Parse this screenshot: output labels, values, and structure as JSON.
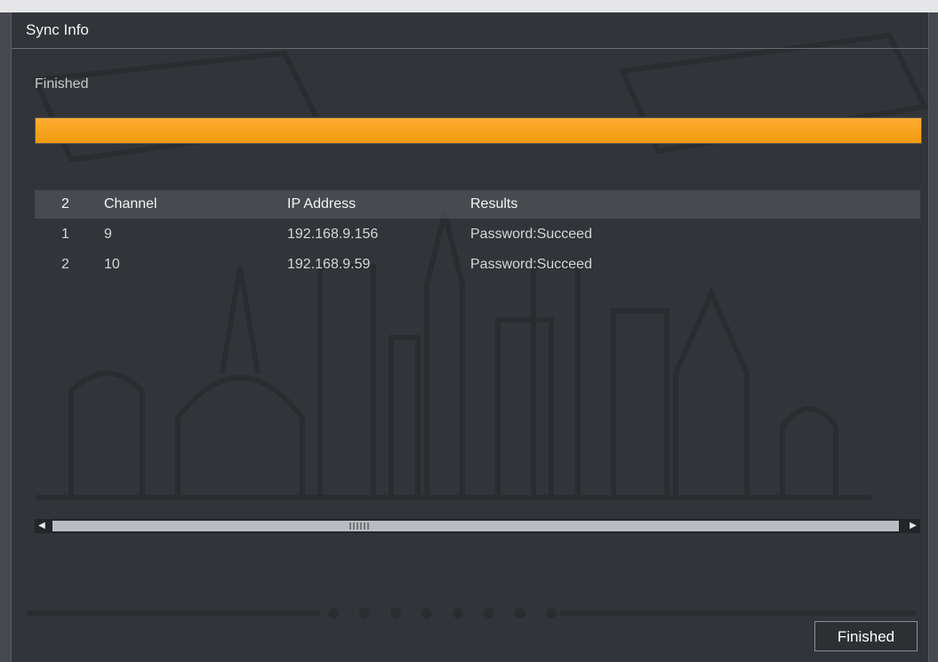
{
  "dialog": {
    "title": "Sync Info",
    "status": "Finished",
    "progress": 1.0,
    "progress_color": "#f7a21b",
    "table": {
      "count": "2",
      "headers": {
        "channel": "Channel",
        "ip": "IP Address",
        "results": "Results"
      },
      "rows": [
        {
          "index": "1",
          "channel": "9",
          "ip": "192.168.9.156",
          "result": "Password:Succeed"
        },
        {
          "index": "2",
          "channel": "10",
          "ip": "192.168.9.59",
          "result": "Password:Succeed"
        }
      ]
    },
    "finished_button": "Finished"
  }
}
